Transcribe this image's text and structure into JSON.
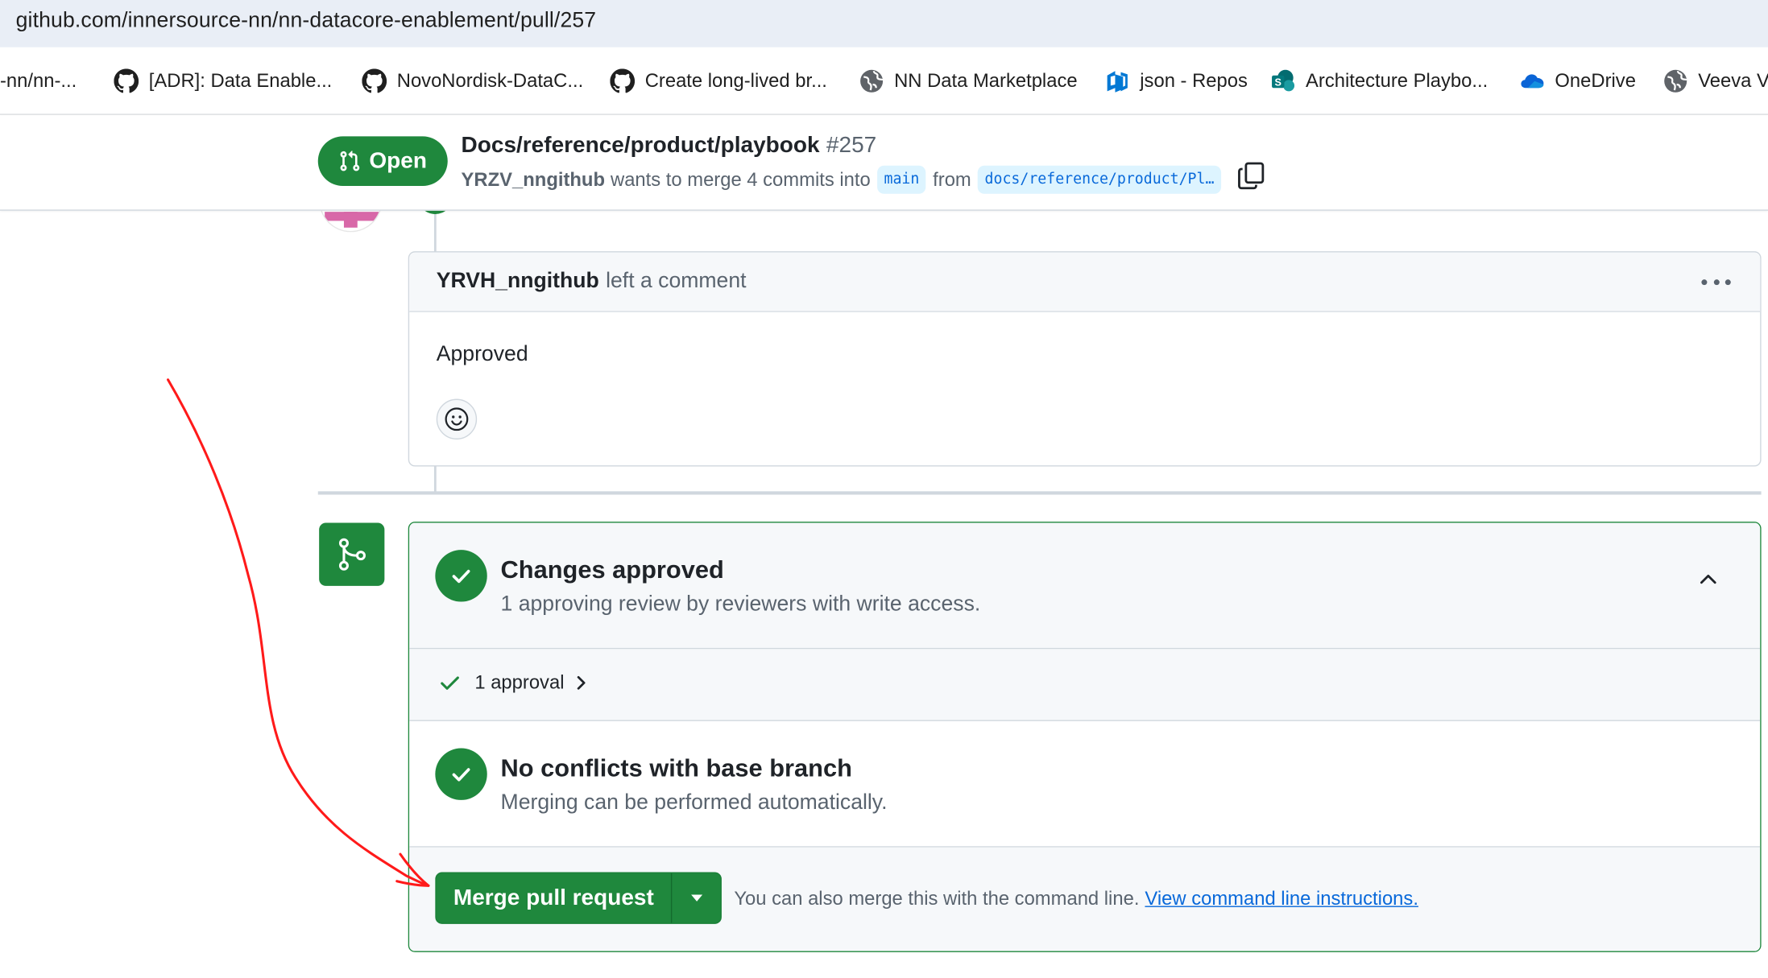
{
  "browser": {
    "url": "github.com/innersource-nn/nn-datacore-enablement/pull/257"
  },
  "bookmarks": [
    {
      "label": "-nn/nn-...",
      "icon": "none"
    },
    {
      "label": "[ADR]: Data Enable...",
      "icon": "github-icon"
    },
    {
      "label": "NovoNordisk-DataC...",
      "icon": "github-icon"
    },
    {
      "label": "Create long-lived br...",
      "icon": "github-icon"
    },
    {
      "label": "NN Data Marketplace",
      "icon": "globe-icon"
    },
    {
      "label": "json - Repos",
      "icon": "azure-devops-icon"
    },
    {
      "label": "Architecture Playbo...",
      "icon": "sharepoint-icon"
    },
    {
      "label": "OneDrive",
      "icon": "onedrive-icon"
    },
    {
      "label": "Veeva Va",
      "icon": "globe-icon"
    }
  ],
  "pr": {
    "state": "Open",
    "title": "Docs/reference/product/playbook",
    "number": "#257",
    "author": "YRZV_nngithub",
    "merge_text": "wants to merge 4 commits into",
    "base_branch": "main",
    "from_text": "from",
    "head_branch": "docs/reference/product/Pl…"
  },
  "comment": {
    "author": "YRVH_nngithub",
    "action": "left a comment",
    "body": "Approved"
  },
  "merge_box": {
    "approved_title": "Changes approved",
    "approved_sub": "1 approving review by reviewers with write access.",
    "approvals_label": "1 approval",
    "conflicts_title": "No conflicts with base branch",
    "conflicts_sub": "Merging can be performed automatically.",
    "merge_button": "Merge pull request",
    "hint_text": "You can also merge this with the command line.",
    "hint_link": "View command line instructions."
  },
  "colors": {
    "accent_green": "#1f883d",
    "link_blue": "#0969da",
    "annotation_red": "#ff1a1a"
  }
}
